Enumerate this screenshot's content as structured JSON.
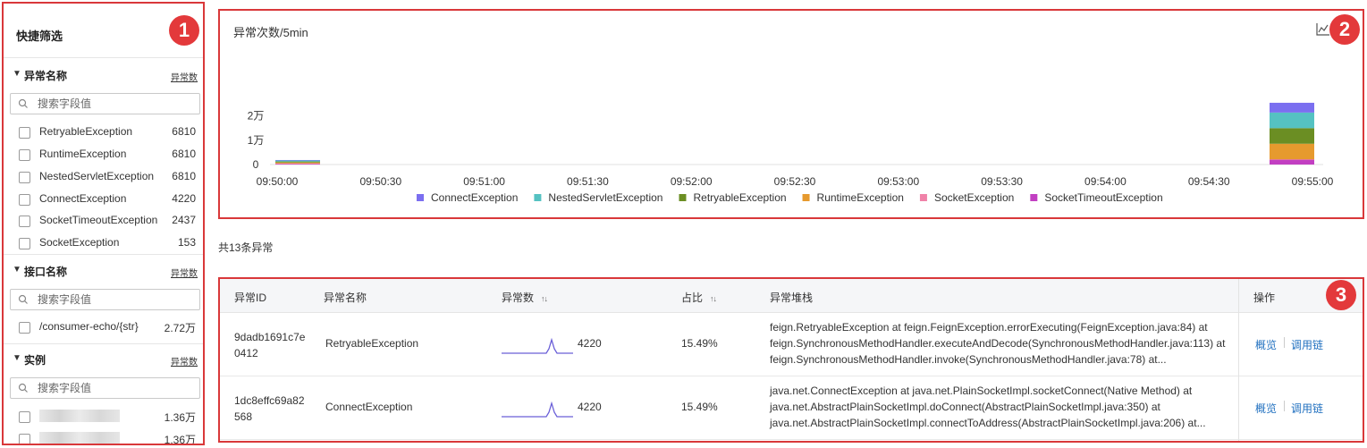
{
  "filter": {
    "title": "快捷筛选",
    "badge": "1",
    "sections": [
      {
        "title": "异常名称",
        "sort_label": "异常数",
        "search_placeholder": "搜索字段值",
        "options": [
          {
            "label": "RetryableException",
            "count": "6810"
          },
          {
            "label": "RuntimeException",
            "count": "6810"
          },
          {
            "label": "NestedServletException",
            "count": "6810"
          },
          {
            "label": "ConnectException",
            "count": "4220"
          },
          {
            "label": "SocketTimeoutException",
            "count": "2437"
          },
          {
            "label": "SocketException",
            "count": "153"
          }
        ]
      },
      {
        "title": "接口名称",
        "sort_label": "异常数",
        "search_placeholder": "搜索字段值",
        "options": [
          {
            "label": "/consumer-echo/{str}",
            "count": "2.72万"
          }
        ]
      },
      {
        "title": "实例",
        "sort_label": "异常数",
        "search_placeholder": "搜索字段值",
        "options": [
          {
            "label": "",
            "count": "1.36万"
          },
          {
            "label": "",
            "count": "1.36万"
          }
        ]
      }
    ]
  },
  "chart_panel": {
    "badge": "2",
    "title": "异常次数/5min",
    "icon": "line-chart-icon"
  },
  "chart_data": {
    "type": "bar",
    "stacked": true,
    "title": "异常次数/5min",
    "x_ticks": [
      "09:50:00",
      "09:50:30",
      "09:51:00",
      "09:51:30",
      "09:52:00",
      "09:52:30",
      "09:53:00",
      "09:53:30",
      "09:54:00",
      "09:54:30",
      "09:55:00"
    ],
    "y_ticks": [
      "0",
      "1万",
      "2万"
    ],
    "y_tick_values": [
      0,
      10000,
      20000
    ],
    "ylim": [
      0,
      25000
    ],
    "x_seconds_range": [
      0,
      300
    ],
    "bars": [
      {
        "x": "09:50:00",
        "x_seconds": 0
      },
      {
        "x": "09:55:00",
        "x_seconds": 300
      }
    ],
    "series": [
      {
        "name": "ConnectException",
        "color": "#7b6ff0",
        "values": [
          200,
          4020
        ]
      },
      {
        "name": "NestedServletException",
        "color": "#55c2c2",
        "values": [
          400,
          6410
        ]
      },
      {
        "name": "RetryableException",
        "color": "#6b8e23",
        "values": [
          400,
          6410
        ]
      },
      {
        "name": "RuntimeException",
        "color": "#e69a2e",
        "values": [
          400,
          6410
        ]
      },
      {
        "name": "SocketException",
        "color": "#f082a8",
        "values": [
          150,
          3
        ]
      },
      {
        "name": "SocketTimeoutException",
        "color": "#c23fc2",
        "values": [
          300,
          2137
        ]
      }
    ],
    "legend_position": "bottom",
    "grid": false
  },
  "summary": {
    "count_text": "共13条异常"
  },
  "table": {
    "badge": "3",
    "columns": {
      "id": "异常ID",
      "name": "异常名称",
      "count": "异常数",
      "ratio": "占比",
      "stack": "异常堆栈",
      "ops": "操作"
    },
    "sort_icon": "↑↓",
    "rows": [
      {
        "id": "9dadb1691c7e0412",
        "name": "RetryableException",
        "count": "4220",
        "ratio": "15.49%",
        "stack": [
          "feign.RetryableException at feign.FeignException.errorExecuting(FeignException.java:84) at",
          "feign.SynchronousMethodHandler.executeAndDecode(SynchronousMethodHandler.java:113) at",
          "feign.SynchronousMethodHandler.invoke(SynchronousMethodHandler.java:78) at..."
        ],
        "action_overview": "概览",
        "action_trace": "调用链"
      },
      {
        "id": "1dc8effc69a82568",
        "name": "ConnectException",
        "count": "4220",
        "ratio": "15.49%",
        "stack": [
          "java.net.ConnectException at java.net.PlainSocketImpl.socketConnect(Native Method) at",
          "java.net.AbstractPlainSocketImpl.doConnect(AbstractPlainSocketImpl.java:350) at",
          "java.net.AbstractPlainSocketImpl.connectToAddress(AbstractPlainSocketImpl.java:206) at..."
        ],
        "action_overview": "概览",
        "action_trace": "调用链"
      }
    ]
  }
}
